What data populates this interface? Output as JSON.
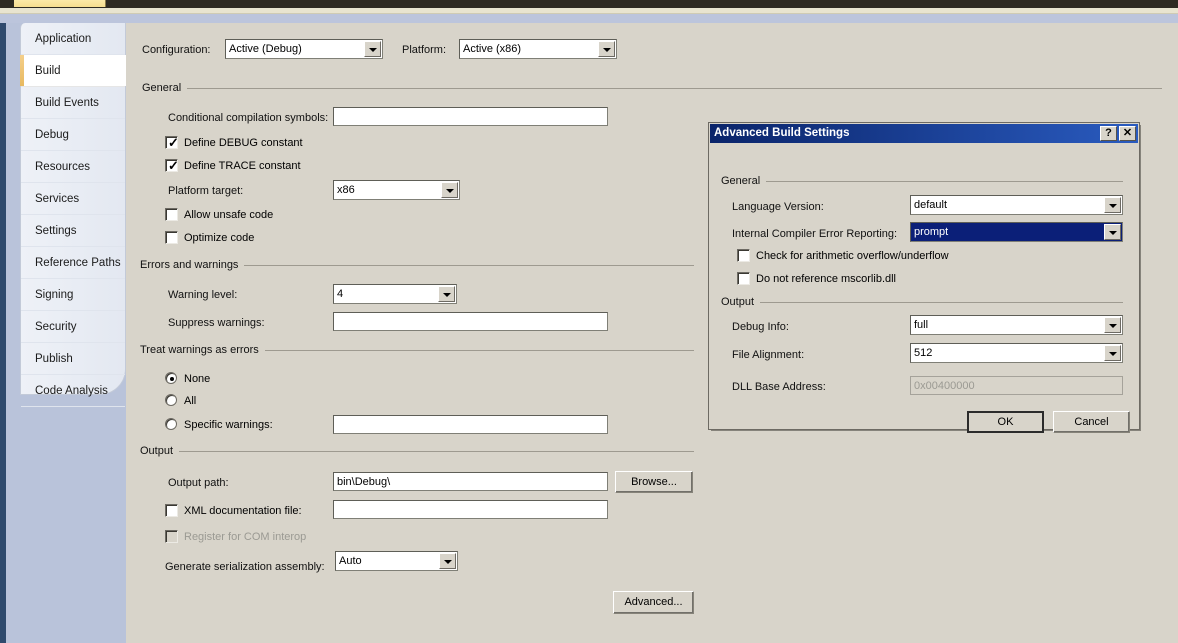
{
  "window": {
    "top_tab_label": ""
  },
  "sidebar": {
    "items": [
      {
        "label": "Application",
        "selected": false
      },
      {
        "label": "Build",
        "selected": true
      },
      {
        "label": "Build Events",
        "selected": false
      },
      {
        "label": "Debug",
        "selected": false
      },
      {
        "label": "Resources",
        "selected": false
      },
      {
        "label": "Services",
        "selected": false
      },
      {
        "label": "Settings",
        "selected": false
      },
      {
        "label": "Reference Paths",
        "selected": false
      },
      {
        "label": "Signing",
        "selected": false
      },
      {
        "label": "Security",
        "selected": false
      },
      {
        "label": "Publish",
        "selected": false
      },
      {
        "label": "Code Analysis",
        "selected": false
      }
    ]
  },
  "toolbar": {
    "configuration_label": "Configuration:",
    "configuration_value": "Active (Debug)",
    "platform_label": "Platform:",
    "platform_value": "Active (x86)"
  },
  "general": {
    "group_label": "General",
    "cond_symbols_label": "Conditional compilation symbols:",
    "cond_symbols_value": "",
    "define_debug_label": "Define DEBUG constant",
    "define_debug_checked": true,
    "define_trace_label": "Define TRACE constant",
    "define_trace_checked": true,
    "platform_target_label": "Platform target:",
    "platform_target_value": "x86",
    "allow_unsafe_label": "Allow unsafe code",
    "allow_unsafe_checked": false,
    "optimize_label": "Optimize code",
    "optimize_checked": false
  },
  "errors_warnings": {
    "group_label": "Errors and warnings",
    "warning_level_label": "Warning level:",
    "warning_level_value": "4",
    "suppress_label": "Suppress warnings:",
    "suppress_value": ""
  },
  "treat_warnings": {
    "group_label": "Treat warnings as errors",
    "none_label": "None",
    "all_label": "All",
    "specific_label": "Specific warnings:",
    "specific_value": "",
    "selected": "None"
  },
  "output": {
    "group_label": "Output",
    "output_path_label": "Output path:",
    "output_path_value": "bin\\Debug\\",
    "browse_label": "Browse...",
    "xml_doc_label": "XML documentation file:",
    "xml_doc_checked": false,
    "xml_doc_value": "",
    "com_interop_label": "Register for COM interop",
    "com_interop_checked": false,
    "com_interop_disabled": true,
    "serialization_label": "Generate serialization assembly:",
    "serialization_value": "Auto",
    "advanced_label": "Advanced..."
  },
  "dialog": {
    "title": "Advanced Build Settings",
    "help_icon": "?",
    "close_icon": "✕",
    "general_group_label": "General",
    "language_version_label": "Language Version:",
    "language_version_value": "default",
    "ice_reporting_label": "Internal Compiler Error Reporting:",
    "ice_reporting_value": "prompt",
    "arith_check_label": "Check for arithmetic overflow/underflow",
    "arith_check_checked": false,
    "no_mscorlib_label": "Do not reference mscorlib.dll",
    "no_mscorlib_checked": false,
    "output_group_label": "Output",
    "debug_info_label": "Debug Info:",
    "debug_info_value": "full",
    "file_alignment_label": "File Alignment:",
    "file_alignment_value": "512",
    "dll_base_label": "DLL Base Address:",
    "dll_base_value": "0x00400000",
    "dll_base_disabled": true,
    "ok_label": "OK",
    "cancel_label": "Cancel"
  },
  "colors": {
    "dialog_titlebar": "#0a246a",
    "selection_highlight": "#0b1f78",
    "window_face": "#d8d4ca",
    "sidebar_accent": "#e8b960",
    "desktop": "#b9c3da"
  }
}
